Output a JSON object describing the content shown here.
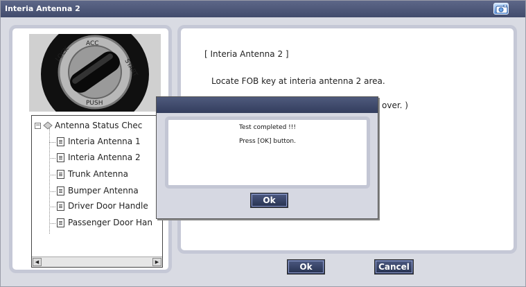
{
  "window": {
    "title": "Interia Antenna 2",
    "camera_icon": "camera-icon"
  },
  "tree": {
    "root_label": "Antenna Status Chec",
    "items": [
      {
        "label": "Interia Antenna 1"
      },
      {
        "label": "Interia Antenna 2"
      },
      {
        "label": "Trunk Antenna"
      },
      {
        "label": "Bumper Antenna"
      },
      {
        "label": "Driver Door Handle"
      },
      {
        "label": "Passenger Door Han"
      }
    ]
  },
  "photo": {
    "ring_texts": [
      "LOCK",
      "ACC",
      "START",
      "PUSH"
    ]
  },
  "instructions": {
    "heading": "[ Interia Antenna 2 ]",
    "line1": "Locate FOB key at interia antenna 2 area.",
    "line2_partial": "over. )"
  },
  "dialog": {
    "message1": "Test completed !!!",
    "message2": "Press [OK] button.",
    "ok_label": "Ok"
  },
  "footer": {
    "ok_label": "Ok",
    "cancel_label": "Cancel"
  }
}
